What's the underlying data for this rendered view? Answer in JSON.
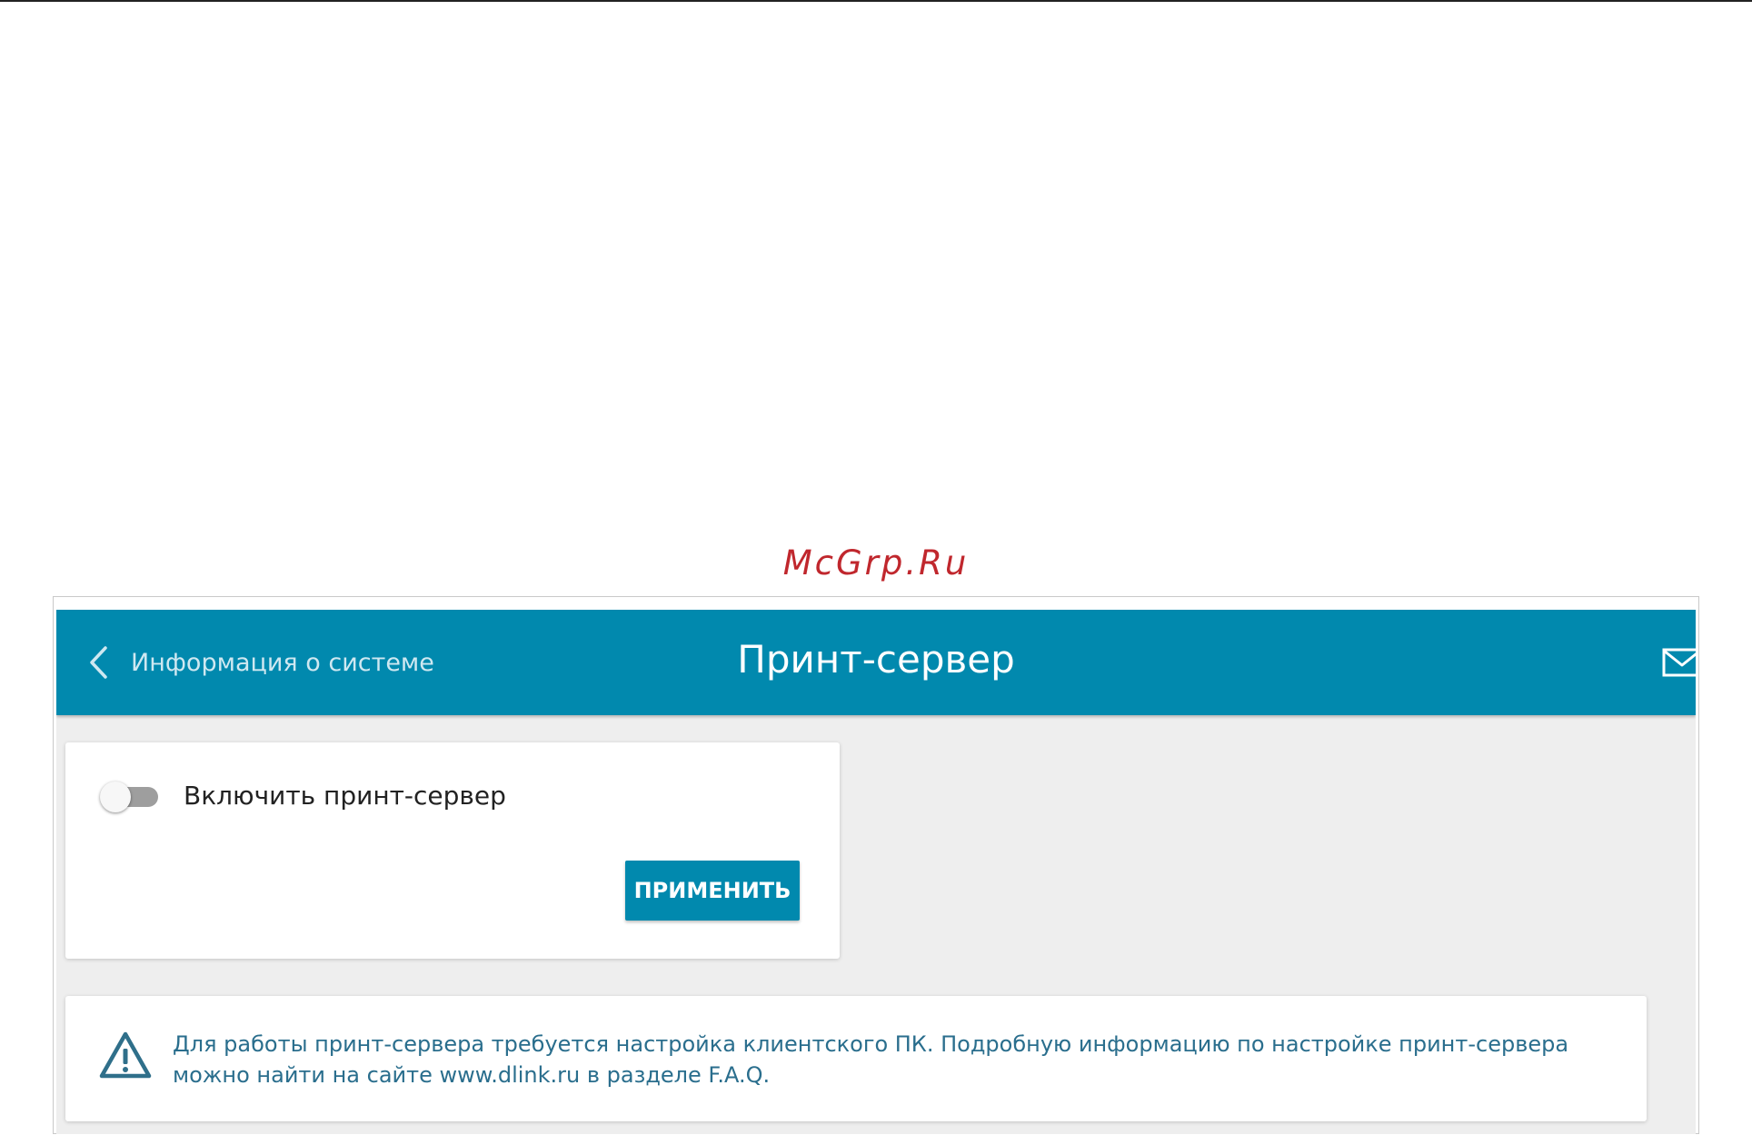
{
  "watermark": "McGrp.Ru",
  "header": {
    "back_label": "Информация о системе",
    "title": "Принт-сервер"
  },
  "settings": {
    "toggle_label": "Включить принт-сервер",
    "toggle_on": false,
    "apply_label": "ПРИМЕНИТЬ"
  },
  "info": {
    "text": "Для работы принт-сервера требуется настройка клиентского ПК. Подробную информацию по настройке принт-сервера можно найти на сайте www.dlink.ru в разделе F.A.Q."
  },
  "colors": {
    "header_bg": "#0189ae",
    "content_bg": "#eeeeee",
    "watermark": "#c0272d",
    "info_text": "#2a6e8d",
    "toggle_off": "#9e9e9e"
  },
  "icons": {
    "back": "chevron-left-icon",
    "mail": "mail-icon",
    "warning": "warning-triangle-icon"
  }
}
